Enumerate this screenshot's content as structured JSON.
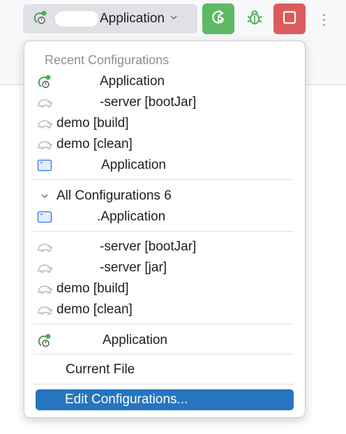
{
  "toolbar": {
    "selected_config": "Application",
    "colors": {
      "run": "#5fb865",
      "stop": "#db5c5c",
      "debug": "#4caf50",
      "popup_selection": "#2675bf"
    }
  },
  "popup": {
    "recent_title": "Recent Configurations",
    "recent": [
      {
        "label": "Application",
        "icon": "spring-boot-run-icon"
      },
      {
        "label": "-server [bootJar]",
        "icon": "gradle-elephant-icon"
      },
      {
        "label": "demo [build]",
        "icon": "gradle-elephant-icon"
      },
      {
        "label": "demo [clean]",
        "icon": "gradle-elephant-icon"
      },
      {
        "label": "Application",
        "icon": "application-window-icon"
      }
    ],
    "all_group": "All Configurations 6",
    "all_items": [
      {
        "label": ".Application",
        "icon": "application-window-icon"
      }
    ],
    "gradle_items": [
      {
        "label": "-server [bootJar]",
        "icon": "gradle-elephant-icon"
      },
      {
        "label": "-server [jar]",
        "icon": "gradle-elephant-icon"
      },
      {
        "label": "demo [build]",
        "icon": "gradle-elephant-icon"
      },
      {
        "label": "demo [clean]",
        "icon": "gradle-elephant-icon"
      }
    ],
    "running": {
      "label": "Application",
      "icon": "spring-boot-run-icon"
    },
    "current_file": "Current File",
    "edit_configurations": "Edit Configurations..."
  }
}
